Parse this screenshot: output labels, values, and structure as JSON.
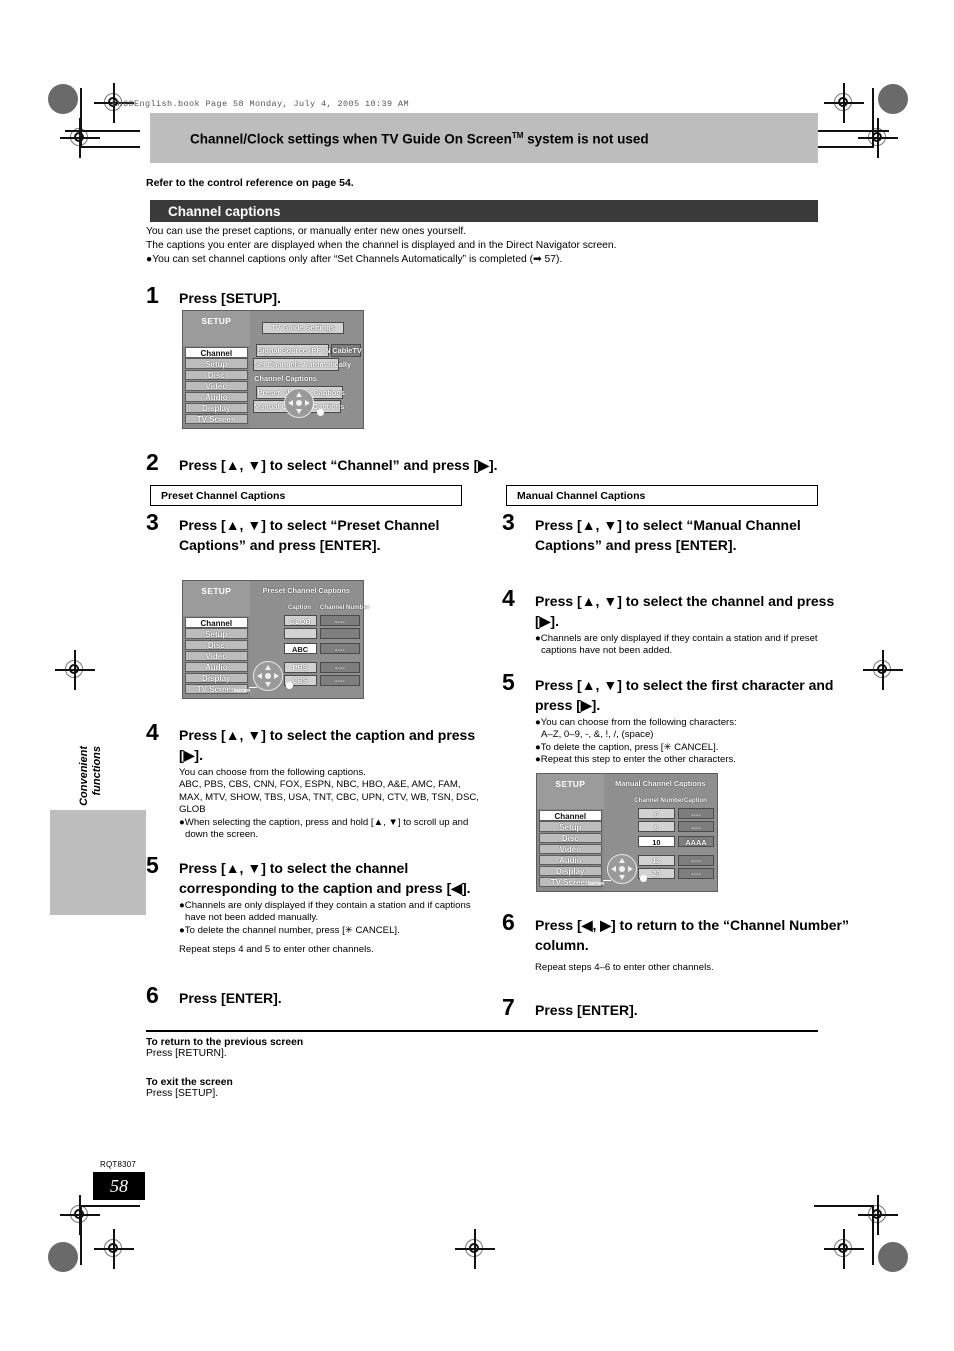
{
  "book_header": "EH60English.book  Page 58  Monday, July 4, 2005  10:39 AM",
  "chapter_banner": {
    "text_before": "Channel/Clock settings when TV Guide On Screen",
    "trademark": "TM",
    "text_after": " system is not used"
  },
  "refer_line": "Refer to the control reference on page 54.",
  "section_bar": {
    "title": "Channel captions"
  },
  "intro": {
    "line1": "You can use the preset captions, or manually enter new ones yourself.",
    "line2": "The captions you enter are displayed when the channel is displayed and in the Direct Navigator screen.",
    "line3": "●You can set channel captions only after “Set Channels Automatically” is completed (➡ 57)."
  },
  "steps": {
    "s1": {
      "num": "1",
      "headline": "Press [SETUP]."
    },
    "s2": {
      "num": "2",
      "headline": "Press [▲, ▼] to select “Channel” and press [▶]."
    }
  },
  "left_column": {
    "label": "Preset Channel Captions",
    "s3": {
      "num": "3",
      "headline": "Press [▲, ▼] to select “Preset Channel Captions” and press [ENTER]."
    },
    "s4": {
      "num": "4",
      "headline": "Press [▲, ▼] to select the caption and press [▶].",
      "note1": "You can choose from the following captions.",
      "note2": "ABC, PBS, CBS, CNN, FOX, ESPN, NBC, HBO, A&E, AMC, FAM, MAX, MTV, SHOW, TBS, USA, TNT, CBC, UPN, CTV, WB, TSN, DSC, GLOB",
      "note3": "●When selecting the caption, press and hold [▲, ▼] to scroll up and down the screen."
    },
    "s5": {
      "num": "5",
      "headline": "Press [▲, ▼] to select the channel corresponding to the caption and press [◀].",
      "note1": "●Channels are only displayed if they contain a station and if captions have not been added manually.",
      "note2": "●To delete the channel number, press [✳ CANCEL].",
      "note3": "Repeat steps 4 and 5 to enter other channels."
    },
    "s6": {
      "num": "6",
      "headline": "Press [ENTER]."
    }
  },
  "right_column": {
    "label": "Manual Channel Captions",
    "s3": {
      "num": "3",
      "headline": "Press [▲, ▼] to select “Manual Channel Captions” and press [ENTER]."
    },
    "s4": {
      "num": "4",
      "headline": "Press [▲, ▼] to select the channel and press [▶].",
      "note1": "●Channels are only displayed if they contain a station and if preset captions have not been added."
    },
    "s5": {
      "num": "5",
      "headline": "Press [▲, ▼] to select the first character and press [▶].",
      "note1": "●You can choose from the following characters:",
      "note2": "A–Z, 0–9, -, &, !, /, (space)",
      "note3": "●To delete the caption, press [✳ CANCEL].",
      "note4": "●Repeat this step to enter the other characters."
    },
    "s6": {
      "num": "6",
      "headline": "Press [◀, ▶] to return to the “Channel Number” column.",
      "note1": "Repeat steps 4–6 to enter other channels."
    },
    "s7": {
      "num": "7",
      "headline": "Press [ENTER]."
    }
  },
  "osd_setup": {
    "title": "SETUP",
    "menu": [
      {
        "label": "Channel",
        "selected": true
      },
      {
        "label": "Setup",
        "selected": false
      },
      {
        "label": "Disc",
        "selected": false
      },
      {
        "label": "Video",
        "selected": false
      },
      {
        "label": "Audio",
        "selected": false
      },
      {
        "label": "Display",
        "selected": false
      },
      {
        "label": "TV Screen",
        "selected": false
      }
    ],
    "items": {
      "tv_guide": "TV Guide Settings",
      "signal_source": "Signal Source (RF IN)",
      "signal_value": "CableTV",
      "set_auto": "Set Channels Automatically",
      "channel_captions": "Channel Captions",
      "preset": "Preset Channel Captions",
      "manual": "Manual Channel Captions"
    },
    "enter_label": "ENTER"
  },
  "osd_preset": {
    "title": "SETUP",
    "screen_title": "Preset Channel Captions",
    "menu": [
      {
        "label": "Channel",
        "selected": true
      },
      {
        "label": "Setup",
        "selected": false
      },
      {
        "label": "Disc",
        "selected": false
      },
      {
        "label": "Video",
        "selected": false
      },
      {
        "label": "Audio",
        "selected": false
      },
      {
        "label": "Display",
        "selected": false
      },
      {
        "label": "TV Screen",
        "selected": false
      }
    ],
    "headers": {
      "caption": "Caption",
      "channel_number": "Channel Number"
    },
    "rows": [
      {
        "caption": "GLOB",
        "channel": "----",
        "highlight": false
      },
      {
        "caption": "",
        "channel": "",
        "highlight": false
      },
      {
        "caption": "ABC",
        "channel": "----",
        "highlight": true
      },
      {
        "caption": "PBS",
        "channel": "----",
        "highlight": false
      },
      {
        "caption": "CBS",
        "channel": "----",
        "highlight": false
      }
    ],
    "enter_label": "ENTER"
  },
  "osd_manual": {
    "title": "SETUP",
    "screen_title": "Manual Channel Captions",
    "menu": [
      {
        "label": "Channel",
        "selected": true
      },
      {
        "label": "Setup",
        "selected": false
      },
      {
        "label": "Disc",
        "selected": false
      },
      {
        "label": "Video",
        "selected": false
      },
      {
        "label": "Audio",
        "selected": false
      },
      {
        "label": "Display",
        "selected": false
      },
      {
        "label": "TV Screen",
        "selected": false
      }
    ],
    "headers": {
      "channel_number": "Channel Number",
      "caption": "Caption"
    },
    "rows": [
      {
        "channel": "6",
        "caption": "----",
        "highlight": false
      },
      {
        "channel": "8",
        "caption": "----",
        "highlight": false
      },
      {
        "channel": "10",
        "caption": "AAAA",
        "highlight": true
      },
      {
        "channel": "12",
        "caption": "----",
        "highlight": false
      },
      {
        "channel": "23",
        "caption": "----",
        "highlight": false
      }
    ],
    "enter_label": "ENTER"
  },
  "footnotes": {
    "t1": "To return to the previous screen",
    "b1": "Press [RETURN].",
    "t2": "To exit the screen",
    "b2": "Press [SETUP]."
  },
  "side_tab": {
    "label": "Convenient\nfunctions"
  },
  "page_number": "58",
  "rqt": "RQT8307"
}
